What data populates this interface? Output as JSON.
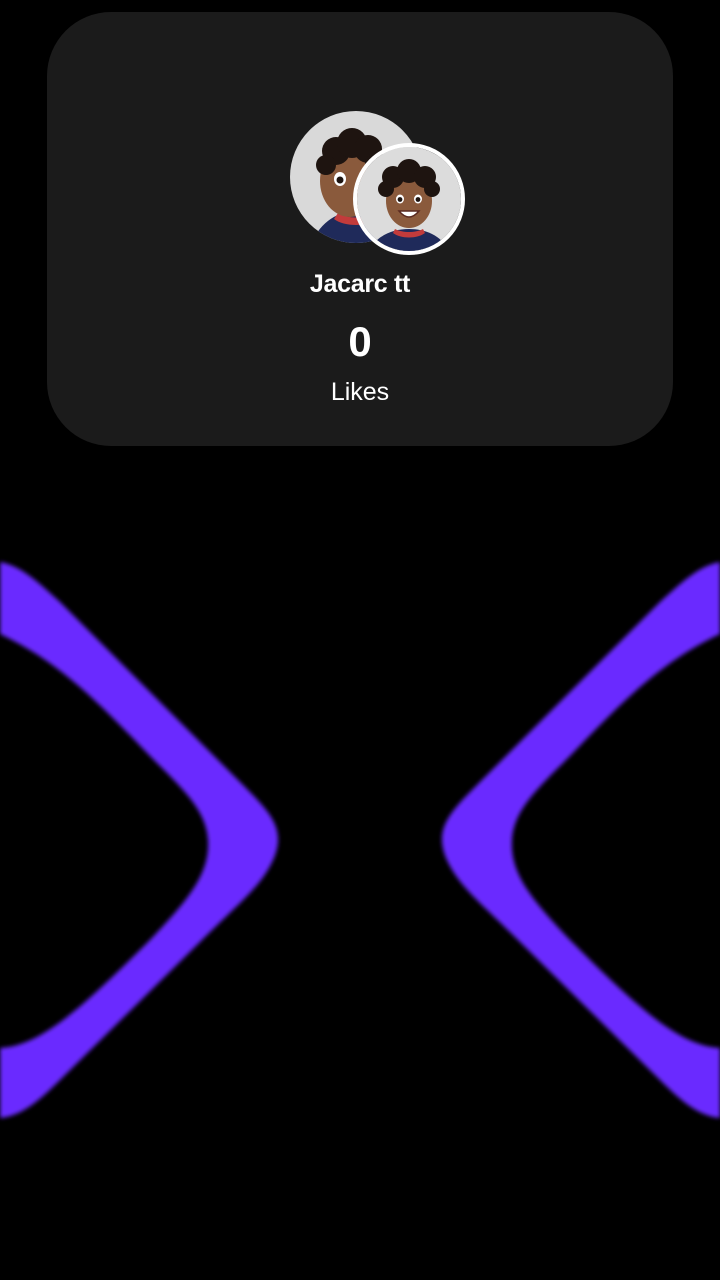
{
  "profile_card": {
    "name": "Jacarc tt",
    "likes_count": "0",
    "likes_label": "Likes"
  },
  "colors": {
    "background": "#000000",
    "card": "#1b1b1b",
    "accent": "#6a2cff"
  },
  "icons": {
    "left_graphic": "left-bracket-shape",
    "right_graphic": "right-bracket-shape"
  }
}
